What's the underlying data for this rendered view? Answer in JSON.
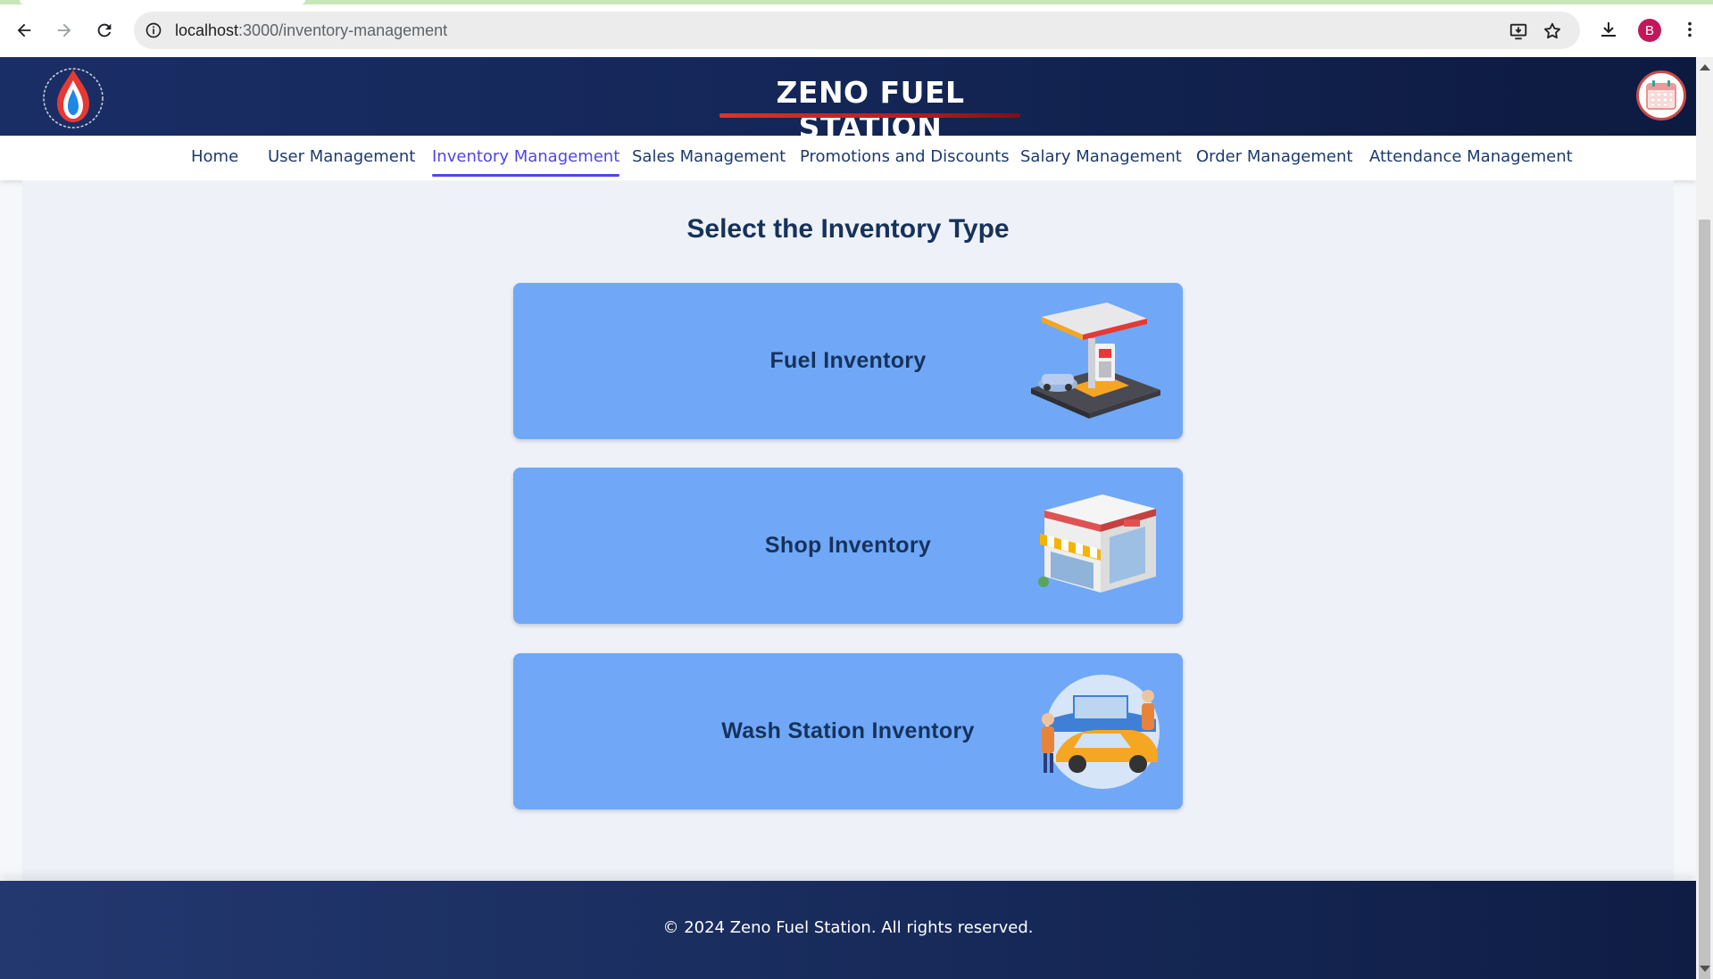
{
  "browser": {
    "url_host": "localhost",
    "url_path": ":3000/inventory-management",
    "profile_initial": "B"
  },
  "header": {
    "title": "ZENO FUEL STATION",
    "logo_icon": "flame-drop-logo",
    "calendar_icon": "calendar-icon"
  },
  "nav": {
    "items": [
      {
        "label": "Home",
        "active": false
      },
      {
        "label": "User Management",
        "active": false
      },
      {
        "label": "Inventory Management",
        "active": true
      },
      {
        "label": "Sales Management",
        "active": false
      },
      {
        "label": "Promotions and Discounts",
        "active": false
      },
      {
        "label": "Salary Management",
        "active": false
      },
      {
        "label": "Order Management",
        "active": false
      },
      {
        "label": "Attendance Management",
        "active": false
      }
    ],
    "active_color": "#4f46e5"
  },
  "main": {
    "title": "Select the Inventory Type",
    "cards": [
      {
        "label": "Fuel Inventory",
        "icon": "gas-station-illustration"
      },
      {
        "label": "Shop Inventory",
        "icon": "shop-illustration"
      },
      {
        "label": "Wash Station Inventory",
        "icon": "car-wash-illustration"
      }
    ],
    "card_color": "#70a8f7"
  },
  "footer": {
    "text": "© 2024 Zeno Fuel Station. All rights reserved."
  }
}
